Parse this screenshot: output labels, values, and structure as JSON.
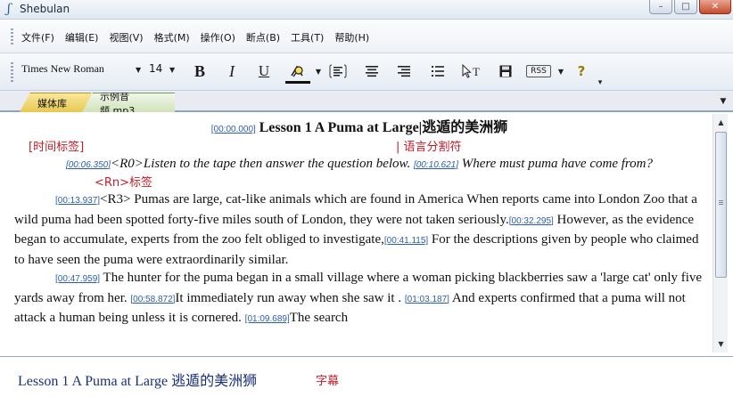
{
  "window": {
    "icon": "ʃ",
    "title": "Shebulan",
    "controls": {
      "minimize": "–",
      "maximize": "□",
      "close": "✕"
    }
  },
  "menu": {
    "items": [
      "文件(F)",
      "编辑(E)",
      "视图(V)",
      "格式(M)",
      "操作(O)",
      "断点(B)",
      "工具(T)",
      "帮助(H)"
    ]
  },
  "toolbar": {
    "font_name": "Times New Roman",
    "font_size": "14",
    "bold": "B",
    "italic": "I",
    "underline": "U",
    "highlight_color": "#111111",
    "rss": "RSS",
    "help": "?",
    "icons": [
      "bold-icon",
      "italic-icon",
      "underline-icon",
      "font-color-icon",
      "align-left-icon",
      "align-center-icon",
      "align-right-icon",
      "list-icon",
      "select-text-icon",
      "save-icon",
      "rss-icon",
      "help-icon"
    ]
  },
  "tabs": [
    {
      "label": "媒体库"
    },
    {
      "label": "示例音频.mp3"
    }
  ],
  "editor": {
    "title_ts": "[00:00.000]",
    "title": "Lesson 1 A Puma at Large|逃遁的美洲狮",
    "note_time": "[时间标签]",
    "note_lang": "| 语言分割符",
    "ts1": "[00:06.350]",
    "line1a": "<R0>Listen to the tape then answer the question below",
    "line1a_end": ".",
    "ts2": "[00:10.621]",
    "line1b": "Where must puma have come from?",
    "note_rn": "<Rn>标签",
    "ts3": "[00:13.937]",
    "p1a": "<R3> Pumas are large, cat-like animals which are found in America  When reports came into London  Zoo that a wild puma had been spotted forty-five miles south of London, they were not taken seriously.",
    "ts4": "[00:32.295]",
    "p1b": " However, as the evidence began to accumulate, experts from the zoo felt obliged to investigate,",
    "ts5": "[00:41.115]",
    "p1c": " For the descriptions given by people who claimed to have seen the puma were extraordinarily similar.",
    "ts6": "[00:47.959]",
    "p2a": " The hunter for the puma began in a small village where a woman picking blackberries saw a 'large cat' only five yards away from her. ",
    "ts7": "[00:58.872]",
    "p2b": "It immediately run away when she saw it . ",
    "ts8": "[01:03.187]",
    "p2c": " And experts confirmed that a puma will not attack a human being unless it is cornered. ",
    "ts9": "[01:09.689]",
    "p2d": "The search"
  },
  "subtitle": {
    "text": "Lesson 1 A Puma at Large 逃遁的美洲狮",
    "label": "字幕"
  },
  "colors": {
    "accent_red": "#c21d2a",
    "timestamp_blue": "#2a5db0",
    "subtitle_navy": "#1a2f7a"
  }
}
